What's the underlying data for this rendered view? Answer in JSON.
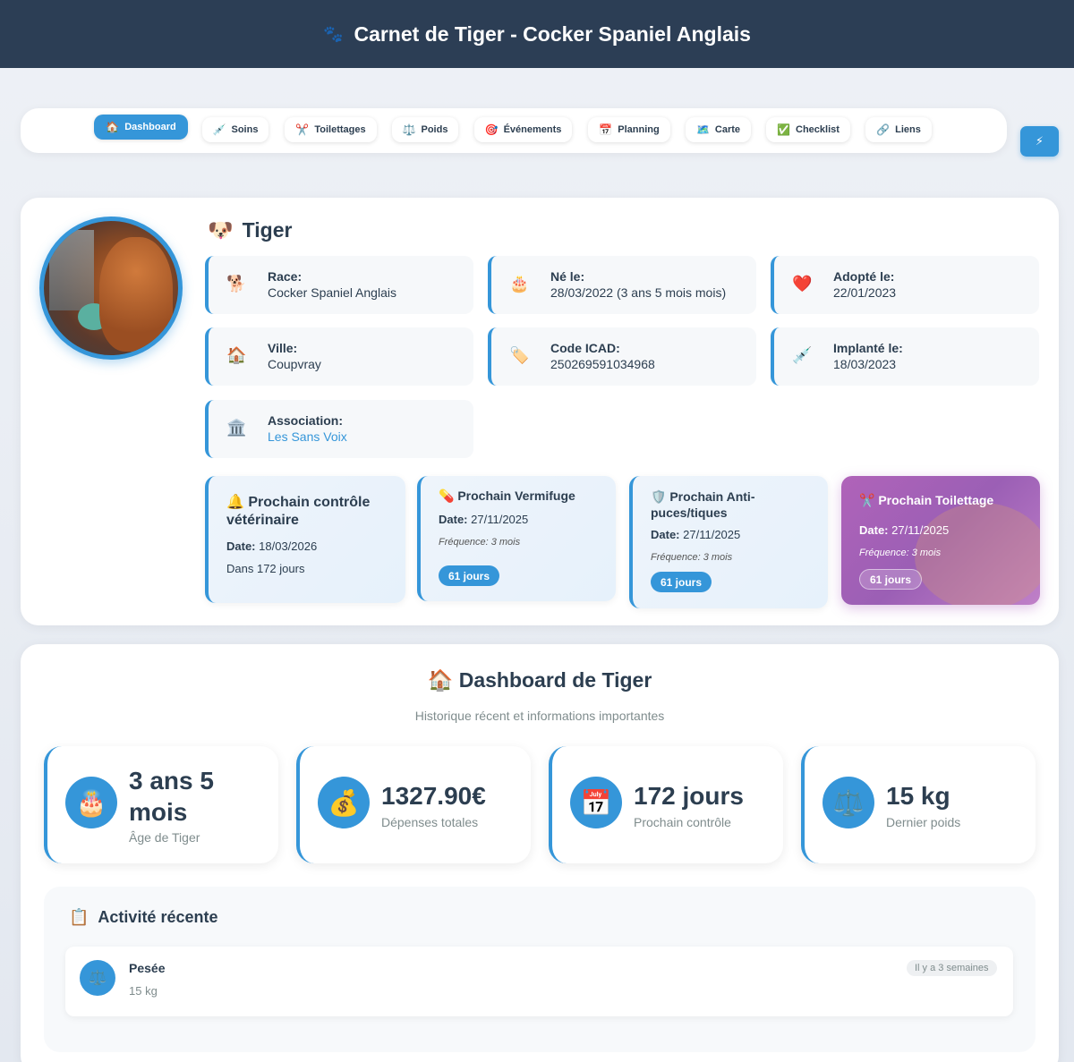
{
  "header": {
    "paw_icon": "🐾",
    "title": "Carnet de Tiger - Cocker Spaniel Anglais"
  },
  "nav": {
    "items": [
      {
        "icon": "🏠",
        "label": "Dashboard",
        "active": true
      },
      {
        "icon": "💉",
        "label": "Soins"
      },
      {
        "icon": "✂️",
        "label": "Toilettages"
      },
      {
        "icon": "⚖️",
        "label": "Poids"
      },
      {
        "icon": "🎯",
        "label": "Événements"
      },
      {
        "icon": "📅",
        "label": "Planning"
      },
      {
        "icon": "🗺️",
        "label": "Carte"
      },
      {
        "icon": "✅",
        "label": "Checklist"
      },
      {
        "icon": "🔗",
        "label": "Liens"
      }
    ],
    "quick_icon": "⚡"
  },
  "profile": {
    "name_icon": "🐶",
    "name": "Tiger",
    "fields": [
      {
        "icon": "🐕",
        "label": "Race:",
        "value": "Cocker Spaniel Anglais"
      },
      {
        "icon": "🎂",
        "label": "Né le:",
        "value": "28/03/2022 (3 ans 5 mois mois)"
      },
      {
        "icon": "❤️",
        "label": "Adopté le:",
        "value": "22/01/2023"
      },
      {
        "icon": "🏠",
        "label": "Ville:",
        "value": "Coupvray"
      },
      {
        "icon": "🏷️",
        "label": "Code ICAD:",
        "value": "250269591034968"
      },
      {
        "icon": "💉",
        "label": "Implanté le:",
        "value": "18/03/2023"
      },
      {
        "icon": "🏛️",
        "label": "Association:",
        "value": "Les Sans Voix"
      }
    ]
  },
  "reminders": {
    "vet": {
      "icon": "🔔",
      "title": "Prochain contrôle vétérinaire",
      "date_label": "Date:",
      "date": "18/03/2026",
      "in": "Dans 172 jours"
    },
    "deworm": {
      "icon": "💊",
      "title": "Prochain Vermifuge",
      "date_label": "Date:",
      "date": "27/11/2025",
      "freq": "Fréquence: 3 mois",
      "badge": "61 jours"
    },
    "flea": {
      "icon": "🛡️",
      "title": "Prochain Anti-puces/tiques",
      "date_label": "Date:",
      "date": "27/11/2025",
      "freq": "Fréquence: 3 mois",
      "badge": "61 jours"
    },
    "groom": {
      "icon": "✂️",
      "title": "Prochain Toilettage",
      "date_label": "Date:",
      "date": "27/11/2025",
      "freq": "Fréquence: 3 mois",
      "badge": "61 jours"
    }
  },
  "dashboard": {
    "icon": "🏠",
    "title": "Dashboard de Tiger",
    "subtitle": "Historique récent et informations importantes",
    "stats": [
      {
        "icon": "🎂",
        "value": "3 ans 5 mois",
        "caption": "Âge de Tiger"
      },
      {
        "icon": "💰",
        "value": "1327.90€",
        "caption": "Dépenses totales"
      },
      {
        "icon": "📅",
        "value": "172 jours",
        "caption": "Prochain contrôle"
      },
      {
        "icon": "⚖️",
        "value": "15 kg",
        "caption": "Dernier poids"
      }
    ]
  },
  "activity": {
    "icon": "📋",
    "title": "Activité récente",
    "items": [
      {
        "icon": "⚖️",
        "name": "Pesée",
        "value": "15 kg",
        "time": "Il y a 3 semaines"
      }
    ]
  },
  "colors": {
    "primary": "#3596d9",
    "header": "#2c3e55",
    "groom_card": "#b063b9"
  }
}
